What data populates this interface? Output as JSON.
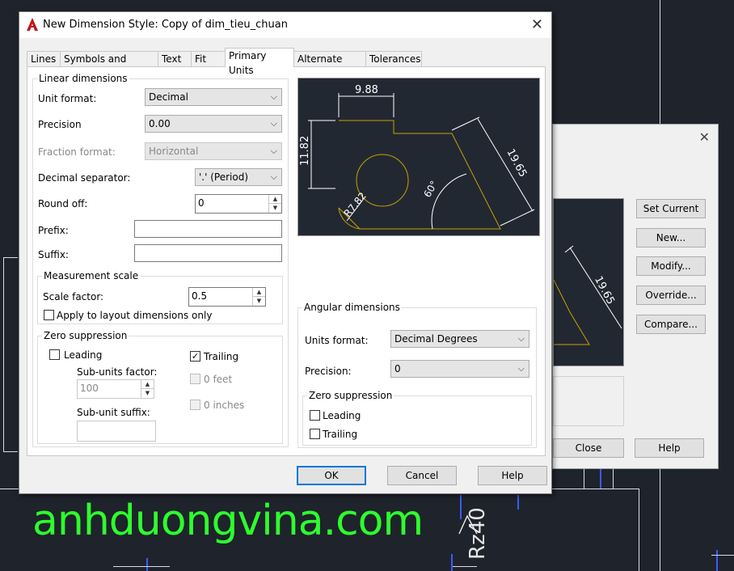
{
  "window": {
    "title": "New Dimension Style: Copy of dim_tieu_chuan"
  },
  "tabs": [
    "Lines",
    "Symbols and Arrows",
    "Text",
    "Fit",
    "Primary Units",
    "Alternate Units",
    "Tolerances"
  ],
  "active_tab": "Primary Units",
  "linear": {
    "title": "Linear dimensions",
    "unit_format_label": "Unit format:",
    "unit_format_value": "Decimal",
    "precision_label": "Precision",
    "precision_value": "0.00",
    "fraction_label": "Fraction format:",
    "fraction_value": "Horizontal",
    "decimal_sep_label": "Decimal separator:",
    "decimal_sep_value": "'.' (Period)",
    "round_off_label": "Round off:",
    "round_off_value": "0",
    "prefix_label": "Prefix:",
    "prefix_value": "",
    "suffix_label": "Suffix:",
    "suffix_value": ""
  },
  "measurement": {
    "title": "Measurement scale",
    "scale_label": "Scale factor:",
    "scale_value": "0.5",
    "layout_label": "Apply to layout dimensions only",
    "layout_checked": false
  },
  "zero_linear": {
    "title": "Zero suppression",
    "leading_label": "Leading",
    "leading_checked": false,
    "trailing_label": "Trailing",
    "trailing_checked": true,
    "sub_factor_label": "Sub-units factor:",
    "sub_factor_value": "100",
    "sub_suffix_label": "Sub-unit suffix:",
    "sub_suffix_value": "",
    "feet_label": "0 feet",
    "inches_label": "0 inches"
  },
  "angular": {
    "title": "Angular dimensions",
    "units_label": "Units format:",
    "units_value": "Decimal Degrees",
    "precision_label": "Precision:",
    "precision_value": "0",
    "zero_title": "Zero suppression",
    "leading_label": "Leading",
    "leading_checked": false,
    "trailing_label": "Trailing",
    "trailing_checked": false
  },
  "preview": {
    "dim_top": "9.88",
    "dim_left": "11.82",
    "dim_right": "19.65",
    "dim_radius": "R7.82",
    "dim_angle": "60°"
  },
  "buttons": {
    "ok": "OK",
    "cancel": "Cancel",
    "help": "Help"
  },
  "back_dialog": {
    "set_current": "Set Current",
    "new": "New...",
    "modify": "Modify...",
    "override": "Override...",
    "compare": "Compare...",
    "close": "Close",
    "help": "Help",
    "preview_dim": "19.65"
  },
  "canvas": {
    "watermark": "anhduongvina.com",
    "rz_label": "Rz40"
  },
  "colors": {
    "accent": "#0078d7",
    "cad_bg": "#222832",
    "cad_geometry": "#c8a000",
    "watermark": "#2dff2d"
  }
}
